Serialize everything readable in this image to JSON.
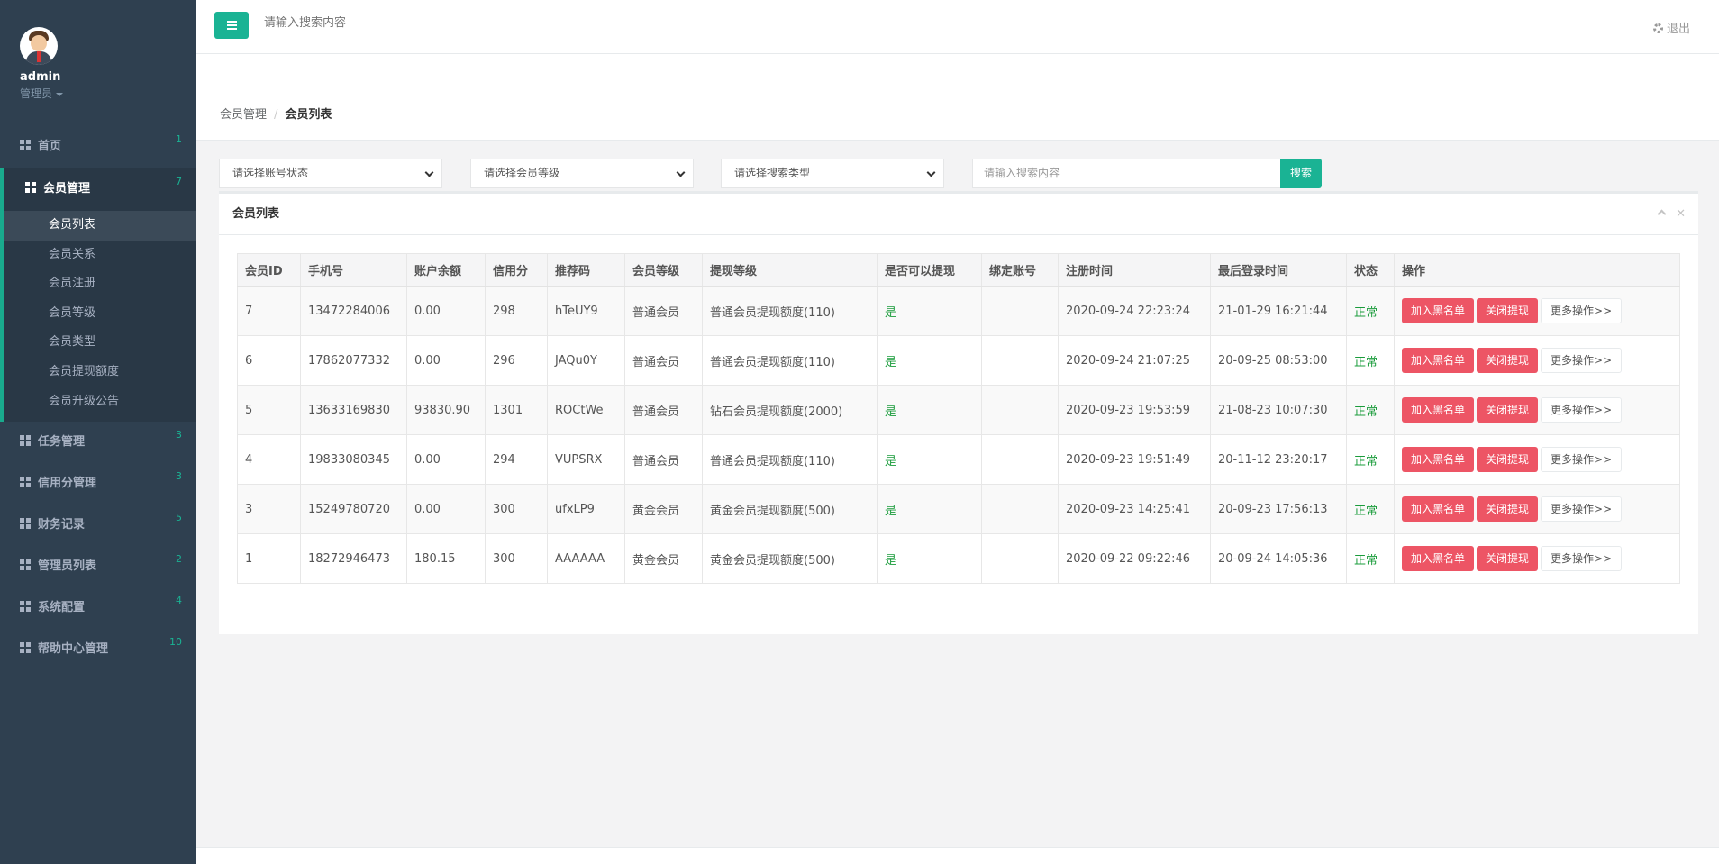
{
  "profile": {
    "name": "admin",
    "role": "管理员"
  },
  "nav": {
    "home": {
      "label": "首页",
      "badge": "1"
    },
    "member": {
      "label": "会员管理",
      "badge": "7",
      "sub": [
        "会员列表",
        "会员关系",
        "会员注册",
        "会员等级",
        "会员类型",
        "会员提现额度",
        "会员升级公告"
      ]
    },
    "task": {
      "label": "任务管理",
      "badge": "3"
    },
    "credit": {
      "label": "信用分管理",
      "badge": "3"
    },
    "finance": {
      "label": "财务记录",
      "badge": "5"
    },
    "admins": {
      "label": "管理员列表",
      "badge": "2"
    },
    "config": {
      "label": "系统配置",
      "badge": "4"
    },
    "help": {
      "label": "帮助中心管理",
      "badge": "10"
    }
  },
  "topbar": {
    "search_placeholder": "请输入搜索内容",
    "logout": "退出"
  },
  "breadcrumb": {
    "parent": "会员管理",
    "sep": "/",
    "current": "会员列表"
  },
  "filters": {
    "account_status": "请选择账号状态",
    "member_level": "请选择会员等级",
    "search_type": "请选择搜索类型",
    "search_placeholder": "请输入搜索内容",
    "search_button": "搜索"
  },
  "panel": {
    "title": "会员列表"
  },
  "table": {
    "headers": [
      "会员ID",
      "手机号",
      "账户余额",
      "信用分",
      "推荐码",
      "会员等级",
      "提现等级",
      "是否可以提现",
      "绑定账号",
      "注册时间",
      "最后登录时间",
      "状态",
      "操作"
    ],
    "rows": [
      [
        "7",
        "13472284006",
        "0.00",
        "298",
        "hTeUY9",
        "普通会员",
        "普通会员提现额度(110)",
        "是",
        "",
        "2020-09-24 22:23:24",
        "21-01-29 16:21:44",
        "正常"
      ],
      [
        "6",
        "17862077332",
        "0.00",
        "296",
        "JAQu0Y",
        "普通会员",
        "普通会员提现额度(110)",
        "是",
        "",
        "2020-09-24 21:07:25",
        "20-09-25 08:53:00",
        "正常"
      ],
      [
        "5",
        "13633169830",
        "93830.90",
        "1301",
        "ROCtWe",
        "普通会员",
        "钻石会员提现额度(2000)",
        "是",
        "",
        "2020-09-23 19:53:59",
        "21-08-23 10:07:30",
        "正常"
      ],
      [
        "4",
        "19833080345",
        "0.00",
        "294",
        "VUPSRX",
        "普通会员",
        "普通会员提现额度(110)",
        "是",
        "",
        "2020-09-23 19:51:49",
        "20-11-12 23:20:17",
        "正常"
      ],
      [
        "3",
        "15249780720",
        "0.00",
        "300",
        "ufxLP9",
        "黄金会员",
        "黄金会员提现额度(500)",
        "是",
        "",
        "2020-09-23 14:25:41",
        "20-09-23 17:56:13",
        "正常"
      ],
      [
        "1",
        "18272946473",
        "180.15",
        "300",
        "AAAAAA",
        "黄金会员",
        "黄金会员提现额度(500)",
        "是",
        "",
        "2020-09-22 09:22:46",
        "20-09-24 14:05:36",
        "正常"
      ]
    ],
    "actions": {
      "blacklist": "加入黑名单",
      "close_withdraw": "关闭提现",
      "more": "更多操作>>"
    }
  },
  "colors": {
    "sidebar": "#2f4050",
    "accent": "#1ab394",
    "danger": "#ed5565"
  }
}
